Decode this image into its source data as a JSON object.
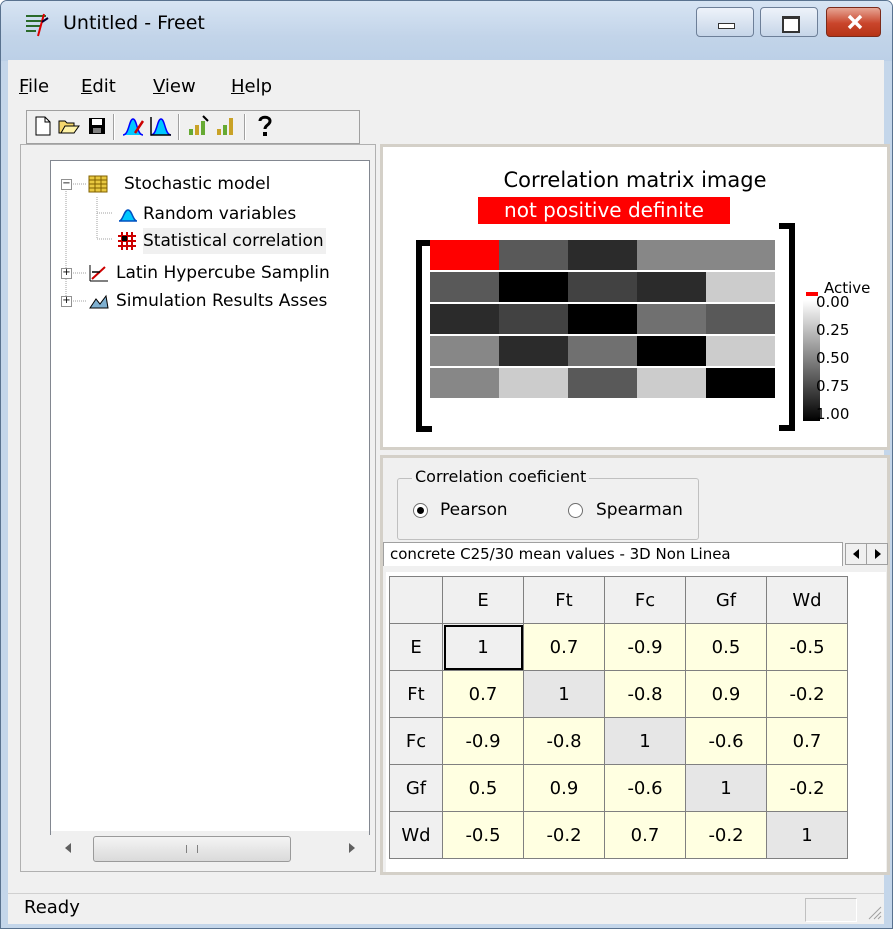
{
  "window": {
    "title": "Untitled - Freet"
  },
  "menu": [
    {
      "label": "File",
      "ul": "F",
      "rest": "ile"
    },
    {
      "label": "Edit",
      "ul": "E",
      "rest": "dit"
    },
    {
      "label": "View",
      "ul": "V",
      "rest": "iew"
    },
    {
      "label": "Help",
      "ul": "H",
      "rest": "elp"
    }
  ],
  "toolbar": [
    "new-icon",
    "open-icon",
    "save-icon",
    "variable-edit-icon",
    "variable-plot-icon",
    "sampling-icon",
    "results-icon",
    "help-icon"
  ],
  "tree": {
    "root": "Stochastic model",
    "random_variables": "Random variables",
    "statistical_correlation": "Statistical correlation",
    "lhs": "Latin Hypercube Samplin",
    "results": "Simulation Results Asses"
  },
  "matrix_image": {
    "title": "Correlation matrix image",
    "warning": "not positive definite",
    "legend": [
      "Active",
      "0.00",
      "0.25",
      "0.50",
      "0.75",
      "1.00"
    ],
    "active_color": "#ff0000"
  },
  "coefficient": {
    "label": "Correlation coeficient",
    "options": [
      "Pearson",
      "Spearman"
    ],
    "selected": "Pearson"
  },
  "tab": {
    "label": "concrete C25/30 mean values - 3D Non Linea"
  },
  "table": {
    "headers": [
      "E",
      "Ft",
      "Fc",
      "Gf",
      "Wd"
    ],
    "rows": [
      {
        "name": "E",
        "values": [
          "1",
          "0.7",
          "-0.9",
          "0.5",
          "-0.5"
        ]
      },
      {
        "name": "Ft",
        "values": [
          "0.7",
          "1",
          "-0.8",
          "0.9",
          "-0.2"
        ]
      },
      {
        "name": "Fc",
        "values": [
          "-0.9",
          "-0.8",
          "1",
          "-0.6",
          "0.7"
        ]
      },
      {
        "name": "Gf",
        "values": [
          "0.5",
          "0.9",
          "-0.6",
          "1",
          "-0.2"
        ]
      },
      {
        "name": "Wd",
        "values": [
          "-0.5",
          "-0.2",
          "0.7",
          "-0.2",
          "1"
        ]
      }
    ],
    "active_cell": "E/E"
  },
  "status": {
    "text": "Ready"
  }
}
